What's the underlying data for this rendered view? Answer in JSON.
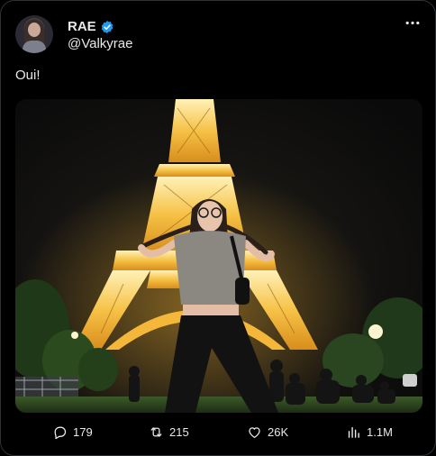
{
  "author": {
    "display_name": "RAE",
    "handle": "@Valkyrae",
    "verified": true
  },
  "tweet": {
    "text": "Oui!"
  },
  "media": {
    "description_visible": false
  },
  "actions": {
    "replies": "179",
    "reposts": "215",
    "likes": "26K",
    "views": "1.1M"
  },
  "colors": {
    "background": "#000000",
    "text": "#e7e9ea",
    "verified_badge": "#1d9bf0",
    "tower_glow": "#f2b132",
    "border": "#2f3336"
  },
  "icons": {
    "verified": "verified-badge-icon",
    "more": "more-options-icon",
    "reply": "reply-icon",
    "repost": "repost-icon",
    "like": "heart-icon",
    "views": "views-chart-icon"
  }
}
